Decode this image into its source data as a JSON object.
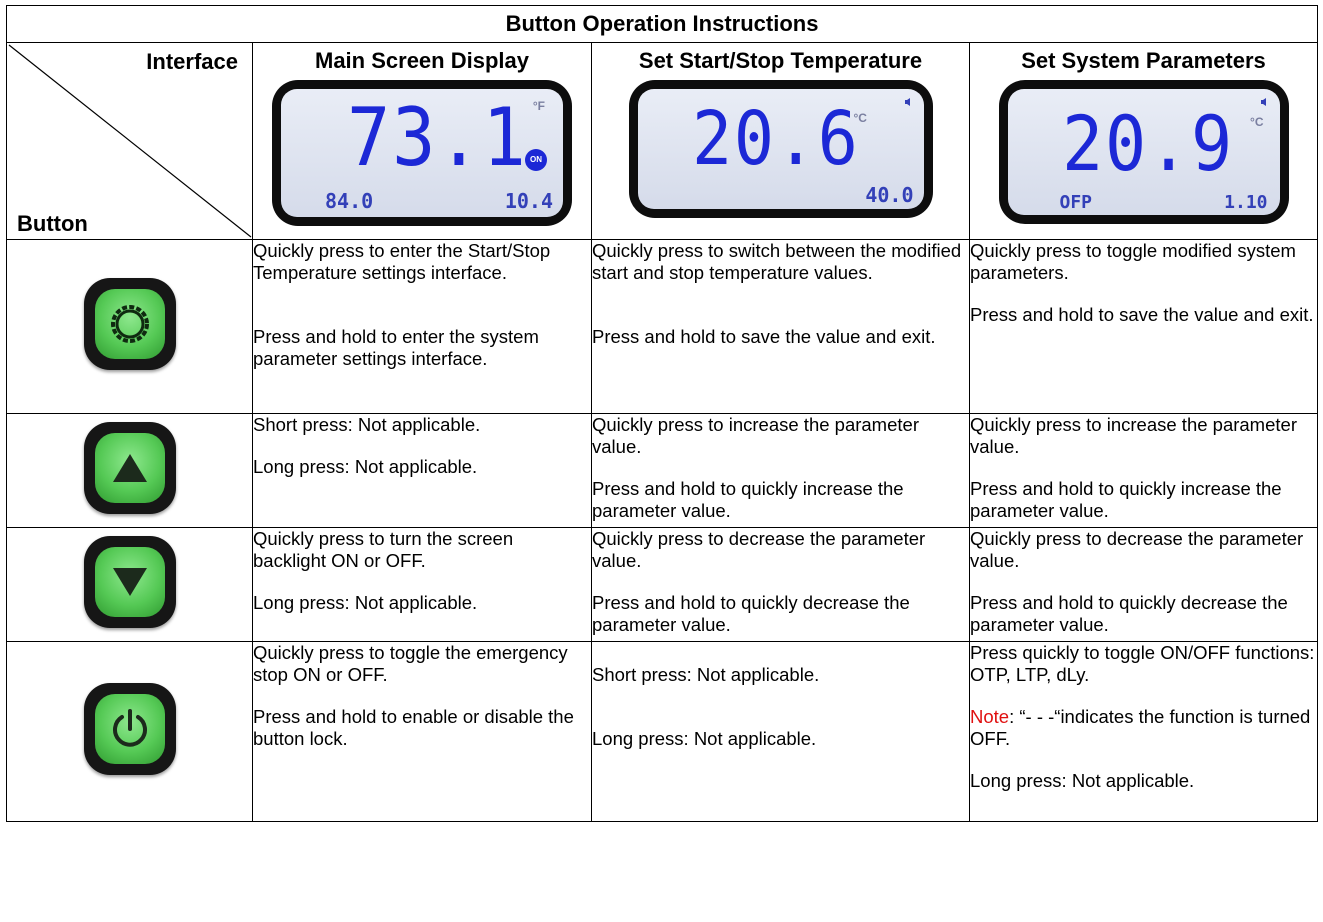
{
  "title": "Button Operation Instructions",
  "corner": {
    "interface_label": "Interface",
    "button_label": "Button"
  },
  "columns": [
    {
      "heading": "Main Screen Display",
      "lcd": {
        "value": "73.1",
        "unit": "°F",
        "badge": "ON",
        "left_small": "84.0",
        "right_small": "10.4"
      }
    },
    {
      "heading": "Set Start/Stop Temperature",
      "lcd": {
        "value": "20.6",
        "unit": "°C",
        "right_small": "40.0"
      }
    },
    {
      "heading": "Set System Parameters",
      "lcd": {
        "value": "20.9",
        "unit": "°C",
        "left_small": "OFP",
        "right_small": "1.10"
      }
    }
  ],
  "rows": [
    {
      "button_icon": "gear-icon",
      "main": [
        "Quickly press to enter the Start/Stop Temperature settings interface.",
        "Press and hold to enter the system parameter settings interface."
      ],
      "startstop": [
        "Quickly press to switch between the modified start and stop temperature values.",
        "Press and hold to save the value and exit."
      ],
      "system": [
        "Quickly press to toggle modified system parameters.",
        "Press and hold to save the value and exit."
      ]
    },
    {
      "button_icon": "up-arrow-icon",
      "main": [
        "Short press: Not applicable.",
        "Long press: Not applicable."
      ],
      "startstop": [
        "Quickly press to increase the parameter value.",
        "Press and hold to quickly increase the parameter value."
      ],
      "system": [
        "Quickly press to increase the parameter value.",
        "Press and hold to quickly increase the parameter value."
      ]
    },
    {
      "button_icon": "down-arrow-icon",
      "main": [
        "Quickly press to turn the screen backlight ON or OFF.",
        "Long press: Not applicable."
      ],
      "startstop": [
        "Quickly press to decrease the parameter value.",
        "Press and hold to quickly decrease the parameter value."
      ],
      "system": [
        "Quickly press to decrease the parameter value.",
        "Press and hold to quickly decrease the parameter value."
      ]
    },
    {
      "button_icon": "power-icon",
      "main": [
        "Quickly press to toggle the emergency stop ON or OFF.",
        "Press and hold to enable or disable the button lock."
      ],
      "startstop": [
        "Short press: Not applicable.",
        "Long press: Not applicable."
      ],
      "system": {
        "p1": "Press quickly to toggle ON/OFF functions: OTP, LTP, dLy.",
        "note_label": "Note",
        "note_text": ": “- - -“indicates the function is turned OFF.",
        "p3": "Long press: Not applicable."
      }
    }
  ]
}
